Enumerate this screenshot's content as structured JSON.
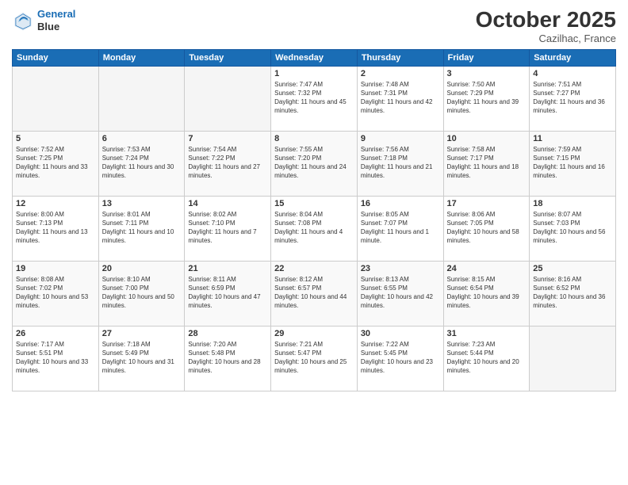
{
  "header": {
    "logo_line1": "General",
    "logo_line2": "Blue",
    "month": "October 2025",
    "location": "Cazilhac, France"
  },
  "days_of_week": [
    "Sunday",
    "Monday",
    "Tuesday",
    "Wednesday",
    "Thursday",
    "Friday",
    "Saturday"
  ],
  "weeks": [
    [
      {
        "num": "",
        "info": ""
      },
      {
        "num": "",
        "info": ""
      },
      {
        "num": "",
        "info": ""
      },
      {
        "num": "1",
        "info": "Sunrise: 7:47 AM\nSunset: 7:32 PM\nDaylight: 11 hours and 45 minutes."
      },
      {
        "num": "2",
        "info": "Sunrise: 7:48 AM\nSunset: 7:31 PM\nDaylight: 11 hours and 42 minutes."
      },
      {
        "num": "3",
        "info": "Sunrise: 7:50 AM\nSunset: 7:29 PM\nDaylight: 11 hours and 39 minutes."
      },
      {
        "num": "4",
        "info": "Sunrise: 7:51 AM\nSunset: 7:27 PM\nDaylight: 11 hours and 36 minutes."
      }
    ],
    [
      {
        "num": "5",
        "info": "Sunrise: 7:52 AM\nSunset: 7:25 PM\nDaylight: 11 hours and 33 minutes."
      },
      {
        "num": "6",
        "info": "Sunrise: 7:53 AM\nSunset: 7:24 PM\nDaylight: 11 hours and 30 minutes."
      },
      {
        "num": "7",
        "info": "Sunrise: 7:54 AM\nSunset: 7:22 PM\nDaylight: 11 hours and 27 minutes."
      },
      {
        "num": "8",
        "info": "Sunrise: 7:55 AM\nSunset: 7:20 PM\nDaylight: 11 hours and 24 minutes."
      },
      {
        "num": "9",
        "info": "Sunrise: 7:56 AM\nSunset: 7:18 PM\nDaylight: 11 hours and 21 minutes."
      },
      {
        "num": "10",
        "info": "Sunrise: 7:58 AM\nSunset: 7:17 PM\nDaylight: 11 hours and 18 minutes."
      },
      {
        "num": "11",
        "info": "Sunrise: 7:59 AM\nSunset: 7:15 PM\nDaylight: 11 hours and 16 minutes."
      }
    ],
    [
      {
        "num": "12",
        "info": "Sunrise: 8:00 AM\nSunset: 7:13 PM\nDaylight: 11 hours and 13 minutes."
      },
      {
        "num": "13",
        "info": "Sunrise: 8:01 AM\nSunset: 7:11 PM\nDaylight: 11 hours and 10 minutes."
      },
      {
        "num": "14",
        "info": "Sunrise: 8:02 AM\nSunset: 7:10 PM\nDaylight: 11 hours and 7 minutes."
      },
      {
        "num": "15",
        "info": "Sunrise: 8:04 AM\nSunset: 7:08 PM\nDaylight: 11 hours and 4 minutes."
      },
      {
        "num": "16",
        "info": "Sunrise: 8:05 AM\nSunset: 7:07 PM\nDaylight: 11 hours and 1 minute."
      },
      {
        "num": "17",
        "info": "Sunrise: 8:06 AM\nSunset: 7:05 PM\nDaylight: 10 hours and 58 minutes."
      },
      {
        "num": "18",
        "info": "Sunrise: 8:07 AM\nSunset: 7:03 PM\nDaylight: 10 hours and 56 minutes."
      }
    ],
    [
      {
        "num": "19",
        "info": "Sunrise: 8:08 AM\nSunset: 7:02 PM\nDaylight: 10 hours and 53 minutes."
      },
      {
        "num": "20",
        "info": "Sunrise: 8:10 AM\nSunset: 7:00 PM\nDaylight: 10 hours and 50 minutes."
      },
      {
        "num": "21",
        "info": "Sunrise: 8:11 AM\nSunset: 6:59 PM\nDaylight: 10 hours and 47 minutes."
      },
      {
        "num": "22",
        "info": "Sunrise: 8:12 AM\nSunset: 6:57 PM\nDaylight: 10 hours and 44 minutes."
      },
      {
        "num": "23",
        "info": "Sunrise: 8:13 AM\nSunset: 6:55 PM\nDaylight: 10 hours and 42 minutes."
      },
      {
        "num": "24",
        "info": "Sunrise: 8:15 AM\nSunset: 6:54 PM\nDaylight: 10 hours and 39 minutes."
      },
      {
        "num": "25",
        "info": "Sunrise: 8:16 AM\nSunset: 6:52 PM\nDaylight: 10 hours and 36 minutes."
      }
    ],
    [
      {
        "num": "26",
        "info": "Sunrise: 7:17 AM\nSunset: 5:51 PM\nDaylight: 10 hours and 33 minutes."
      },
      {
        "num": "27",
        "info": "Sunrise: 7:18 AM\nSunset: 5:49 PM\nDaylight: 10 hours and 31 minutes."
      },
      {
        "num": "28",
        "info": "Sunrise: 7:20 AM\nSunset: 5:48 PM\nDaylight: 10 hours and 28 minutes."
      },
      {
        "num": "29",
        "info": "Sunrise: 7:21 AM\nSunset: 5:47 PM\nDaylight: 10 hours and 25 minutes."
      },
      {
        "num": "30",
        "info": "Sunrise: 7:22 AM\nSunset: 5:45 PM\nDaylight: 10 hours and 23 minutes."
      },
      {
        "num": "31",
        "info": "Sunrise: 7:23 AM\nSunset: 5:44 PM\nDaylight: 10 hours and 20 minutes."
      },
      {
        "num": "",
        "info": ""
      }
    ]
  ]
}
